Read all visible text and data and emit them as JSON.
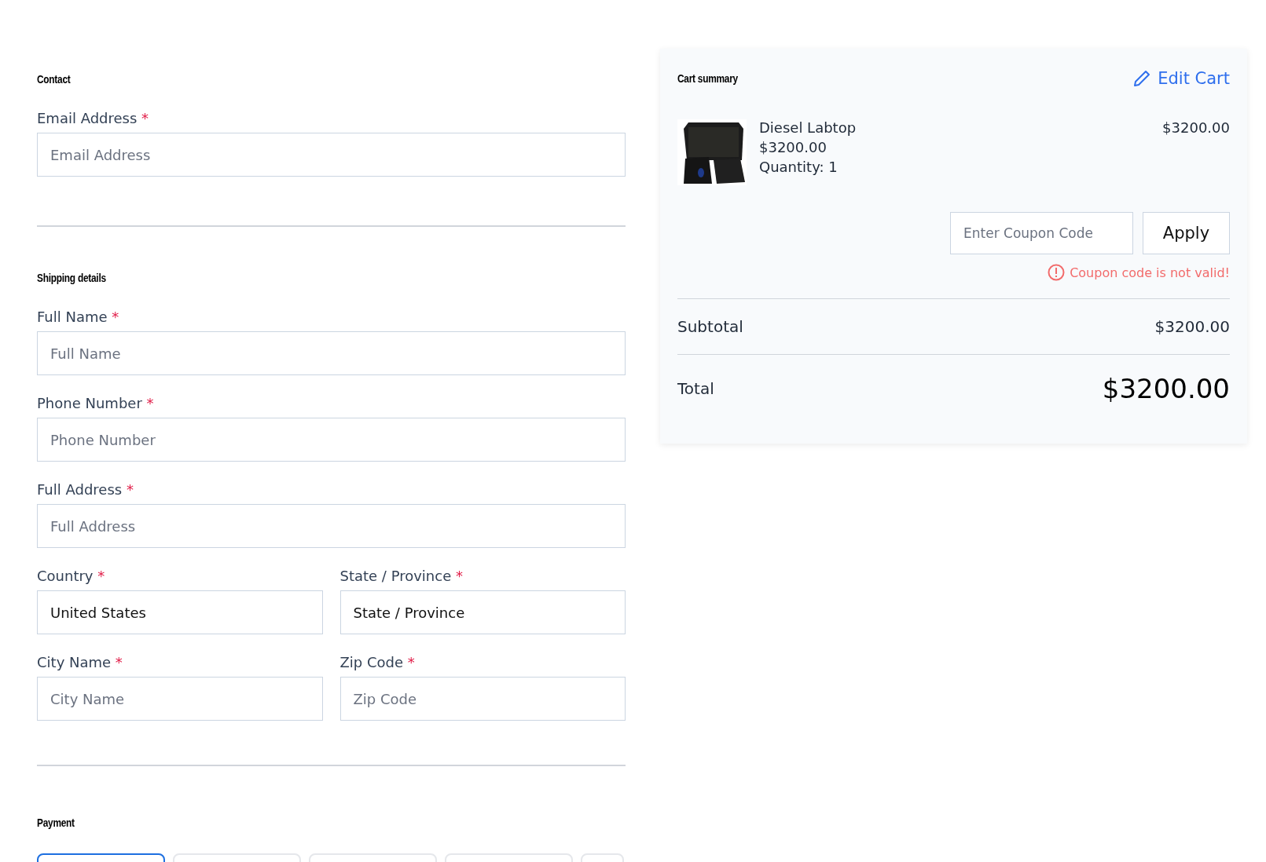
{
  "contact": {
    "heading": "Contact",
    "rows": [
      [
        {
          "label": "Email Address",
          "required_mark": "*",
          "placeholder": "Email Address"
        }
      ]
    ]
  },
  "shipping": {
    "heading": "Shipping details",
    "rows": [
      [
        {
          "label": "Full Name",
          "required_mark": "*",
          "placeholder": "Full Name"
        }
      ],
      [
        {
          "label": "Phone Number",
          "required_mark": "*",
          "placeholder": "Phone Number"
        }
      ],
      [
        {
          "label": "Full Address",
          "required_mark": "*",
          "placeholder": "Full Address"
        }
      ],
      [
        {
          "label": "Country",
          "required_mark": "*",
          "value": "United States"
        },
        {
          "label": "State / Province",
          "required_mark": "*",
          "value": "State / Province"
        }
      ],
      [
        {
          "label": "City Name",
          "required_mark": "*",
          "placeholder": "City Name"
        },
        {
          "label": "Zip Code",
          "required_mark": "*",
          "placeholder": "Zip Code"
        }
      ]
    ]
  },
  "payment": {
    "heading": "Payment",
    "options": [
      {
        "selected": true
      },
      {
        "selected": false
      },
      {
        "selected": false
      },
      {
        "selected": false
      },
      {
        "selected": false
      }
    ]
  },
  "cart": {
    "heading": "Cart summary",
    "edit_link": "Edit Cart",
    "items": [
      {
        "name": "Diesel Labtop",
        "price": "$3200.00",
        "quantity": "Quantity: 1",
        "line_total": "$3200.00"
      }
    ],
    "coupon": {
      "placeholder": "Enter Coupon Code",
      "button": "Apply",
      "error": "Coupon code is not valid!"
    },
    "subtotal": {
      "label": "Subtotal",
      "value": "$3200.00"
    },
    "total": {
      "label": "Total",
      "value": "$3200.00"
    }
  }
}
